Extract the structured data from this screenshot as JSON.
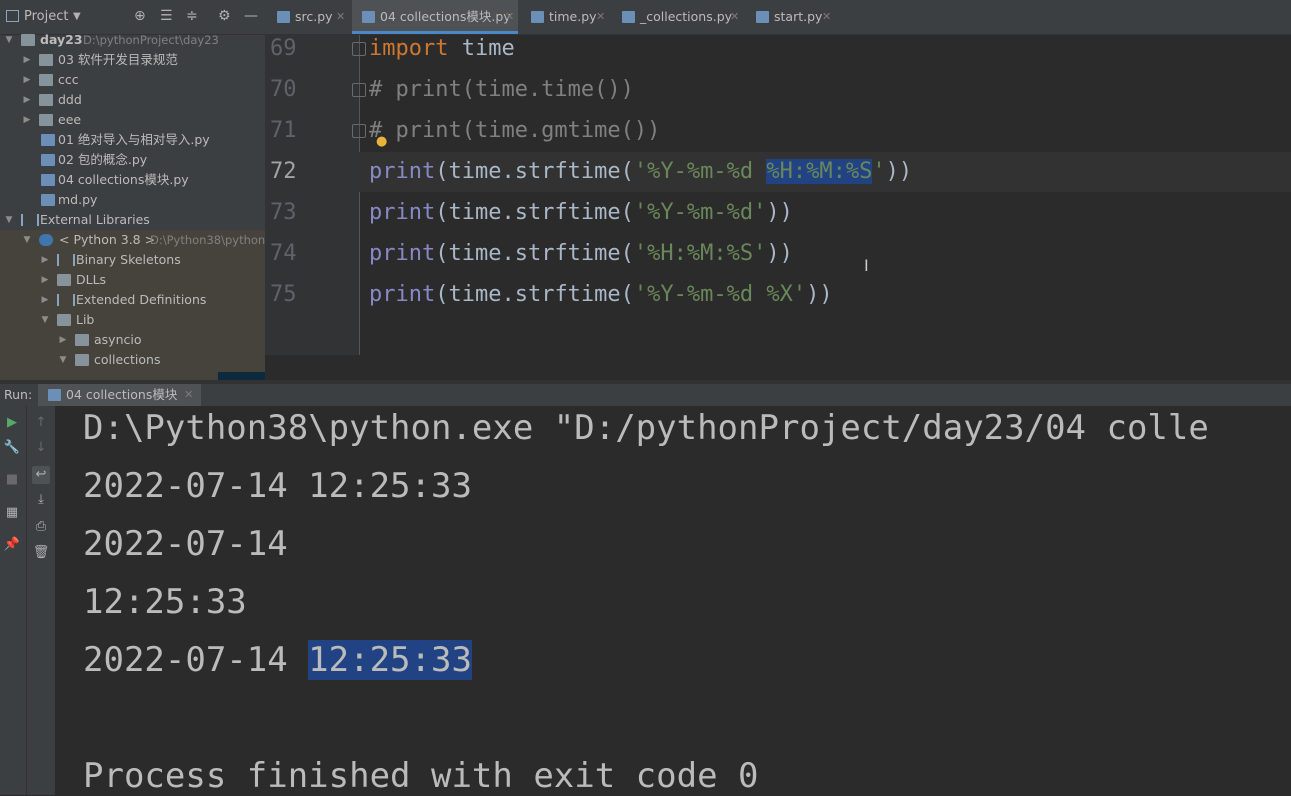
{
  "project_panel": {
    "title": "Project",
    "items": [
      {
        "label": "day23",
        "hint": "D:\\pythonProject\\day23"
      },
      {
        "label": "03 软件开发目录规范"
      },
      {
        "label": "ccc"
      },
      {
        "label": "ddd"
      },
      {
        "label": "eee"
      },
      {
        "label": "01 绝对导入与相对导入.py"
      },
      {
        "label": "02 包的概念.py"
      },
      {
        "label": "04 collections模块.py"
      },
      {
        "label": "md.py"
      },
      {
        "label": "External Libraries"
      },
      {
        "label": "< Python 3.8 >",
        "hint": "D:\\Python38\\python"
      },
      {
        "label": "Binary Skeletons"
      },
      {
        "label": "DLLs"
      },
      {
        "label": "Extended Definitions"
      },
      {
        "label": "Lib"
      },
      {
        "label": "asyncio"
      },
      {
        "label": "collections"
      }
    ]
  },
  "tabs": [
    {
      "label": "src.py"
    },
    {
      "label": "04 collections模块.py"
    },
    {
      "label": "time.py"
    },
    {
      "label": "_collections.py"
    },
    {
      "label": "start.py"
    }
  ],
  "editor": {
    "line_numbers": [
      "69",
      "70",
      "71",
      "72",
      "73",
      "74",
      "75"
    ],
    "lines": {
      "l69_kw": "import",
      "l69_rest": " time",
      "l70": "# print(time.time())",
      "l71": "# print(time.gmtime())",
      "l72_a": "print",
      "l72_b": "(time.strftime(",
      "l72_c": "'%Y-%m-%d ",
      "l72_sel": "%H:%M:%S",
      "l72_d": "'",
      "l72_e": "))",
      "l73_a": "print",
      "l73_b": "(time.strftime(",
      "l73_c": "'%Y-%m-%d'",
      "l73_e": "))",
      "l74_a": "print",
      "l74_b": "(time.strftime(",
      "l74_c": "'%H:%M:%S'",
      "l74_e": "))",
      "l75_a": "print",
      "l75_b": "(time.strftime(",
      "l75_c": "'%Y-%m-%d %X'",
      "l75_e": "))"
    }
  },
  "run": {
    "label": "Run:",
    "tab": "04 collections模块",
    "console": {
      "cmd": "D:\\Python38\\python.exe \"D:/pythonProject/day23/04 colle",
      "out1": "2022-07-14 12:25:33",
      "out2": "2022-07-14",
      "out3": "12:25:33",
      "out4_a": "2022-07-14 ",
      "out4_sel": "12:25:33",
      "exit": "Process finished with exit code 0"
    }
  },
  "colors": {
    "selection": "#214283",
    "keyword": "#cc7832",
    "string": "#6a8759",
    "comment": "#808080",
    "builtin": "#8888c6"
  }
}
